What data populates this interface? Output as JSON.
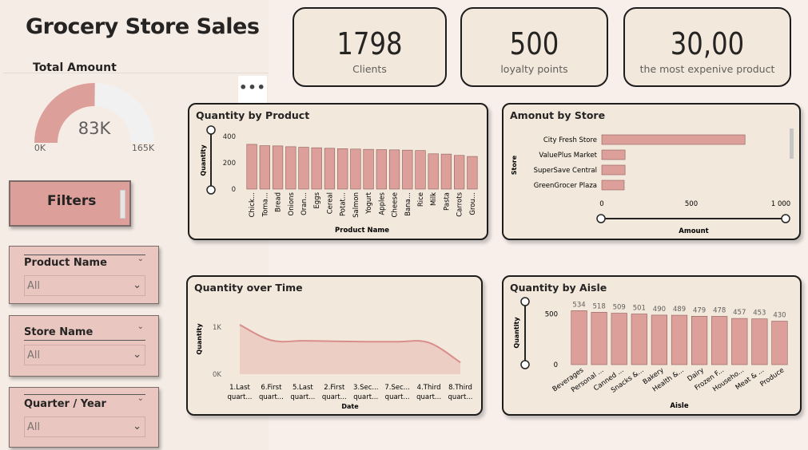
{
  "title": "Grocery Store Sales",
  "gauge": {
    "title": "Total Amount",
    "value_label": "83K",
    "min_label": "0K",
    "max_label": "165K",
    "value": 83,
    "max": 165
  },
  "more_options": "•••",
  "kpis": [
    {
      "value": "1798",
      "label": "Clients"
    },
    {
      "value": "500",
      "label": "loyalty points"
    },
    {
      "value": "30,00",
      "label": "the most expenive product"
    }
  ],
  "filters_label": "Filters",
  "slicers": [
    {
      "name": "Product Name",
      "value": "All"
    },
    {
      "name": "Store Name",
      "value": "All"
    },
    {
      "name": "Quarter / Year",
      "value": "All"
    }
  ],
  "colors": {
    "bar": "#dc9f9a",
    "bar_stroke": "#8f5f5c",
    "area": "#ebc6bd",
    "line": "#d88f8a"
  },
  "chart_data": [
    {
      "type": "bar",
      "title": "Quantity by Product",
      "xlabel": "Product Name",
      "ylabel": "Quantity",
      "ylim": [
        0,
        400
      ],
      "yticks": [
        "400",
        "200",
        "0"
      ],
      "categories": [
        "Chick...",
        "Toma...",
        "Bread",
        "Onions",
        "Oran...",
        "Eggs",
        "Cereal",
        "Potat...",
        "Salmon",
        "Yogurt",
        "Apples",
        "Cheese",
        "Bana...",
        "Rice",
        "Milk",
        "Pasta",
        "Carrots",
        "Grou..."
      ],
      "values": [
        340,
        330,
        328,
        322,
        318,
        314,
        310,
        307,
        304,
        302,
        300,
        298,
        296,
        293,
        268,
        266,
        256,
        248
      ]
    },
    {
      "type": "bar",
      "title": "Amonut by Store",
      "xlabel": "Amount",
      "ylabel": "Store",
      "xlim": [
        0,
        1000
      ],
      "xticks": [
        "0",
        "500",
        "1 000"
      ],
      "categories": [
        "City Fresh Store",
        "ValuePlus Market",
        "SuperSave Central",
        "GreenGrocer Plaza"
      ],
      "values": [
        800,
        130,
        130,
        125
      ]
    },
    {
      "type": "area",
      "title": "Quantity over Time",
      "xlabel": "Date",
      "ylabel": "Quantity",
      "yticks": [
        "1K",
        "0K"
      ],
      "ylim": [
        0,
        1000
      ],
      "categories": [
        [
          "1.Last",
          "quart..."
        ],
        [
          "6.First",
          "quart..."
        ],
        [
          "5.Last",
          "quart..."
        ],
        [
          "2.First",
          "quart..."
        ],
        [
          "3.Sec...",
          "quart..."
        ],
        [
          "7.Sec...",
          "quart..."
        ],
        [
          "4.Third",
          "quart..."
        ],
        [
          "8.Third",
          "quart..."
        ]
      ],
      "values": [
        1050,
        720,
        710,
        700,
        690,
        690,
        670,
        250
      ]
    },
    {
      "type": "bar",
      "title": "Quantity by Aisle",
      "xlabel": "Aisle",
      "ylabel": "Quantity",
      "ylim": [
        0,
        600
      ],
      "yticks": [
        "500",
        "0"
      ],
      "categories": [
        "Beverages",
        "Personal ...",
        "Canned ...",
        "Snacks &...",
        "Bakery",
        "Health &...",
        "Dairy",
        "Frozen F...",
        "Househo...",
        "Meat & ...",
        "Produce"
      ],
      "values": [
        534,
        518,
        509,
        501,
        490,
        489,
        479,
        478,
        457,
        453,
        430
      ],
      "value_labels": [
        "534",
        "518",
        "509",
        "501",
        "490",
        "489",
        "479",
        "478",
        "457",
        "453",
        "430"
      ]
    }
  ]
}
